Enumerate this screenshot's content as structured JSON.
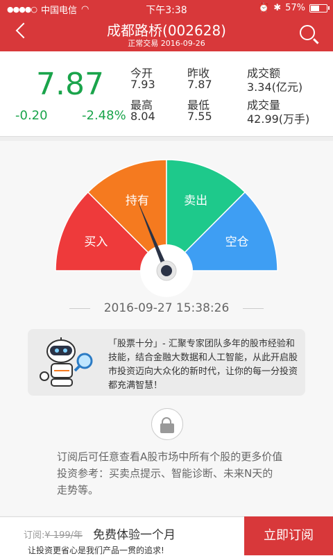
{
  "status_bar": {
    "carrier": "中国电信",
    "time": "下午3:38",
    "battery": "57%"
  },
  "header": {
    "title": "成都路桥(002628)",
    "subtitle": "正常交易  2016-09-26"
  },
  "quote": {
    "price": "7.87",
    "change": "-0.20",
    "change_pct": "-2.48%",
    "stats": [
      {
        "label": "今开",
        "value": "7.93"
      },
      {
        "label": "昨收",
        "value": "7.87"
      },
      {
        "label": "成交额",
        "value": "3.34(亿元)"
      },
      {
        "label": "最高",
        "value": "8.04"
      },
      {
        "label": "最低",
        "value": "7.55"
      },
      {
        "label": "成交量",
        "value": "42.99(万手)"
      }
    ]
  },
  "gauge": {
    "segments": [
      {
        "label": "买入",
        "color": "#ee3a3b"
      },
      {
        "label": "持有",
        "color": "#f57a1f"
      },
      {
        "label": "卖出",
        "color": "#1ec98b"
      },
      {
        "label": "空仓",
        "color": "#3e9ef3"
      }
    ],
    "needle_position": 0.375
  },
  "timestamp": "2016-09-27 15:38:26",
  "intro": "「股票十分」- 汇聚专家团队多年的股市经验和技能，结合金融大数据和人工智能，从此开启股市投资迈向大众化的新时代，让你的每一分投资都充满智慧！",
  "subscribe_desc": "订阅后可任意查看A股市场中所有个股的更多价值投资参考：买卖点提示、智能诊断、未来N天的走势等。",
  "footer": {
    "price_label": "订阅:",
    "price": "¥ 199/年",
    "trial": "免费体验一个月",
    "slogan": "让投资更省心是我们产品一贯的追求!",
    "subscribe_button": "立即订阅"
  }
}
